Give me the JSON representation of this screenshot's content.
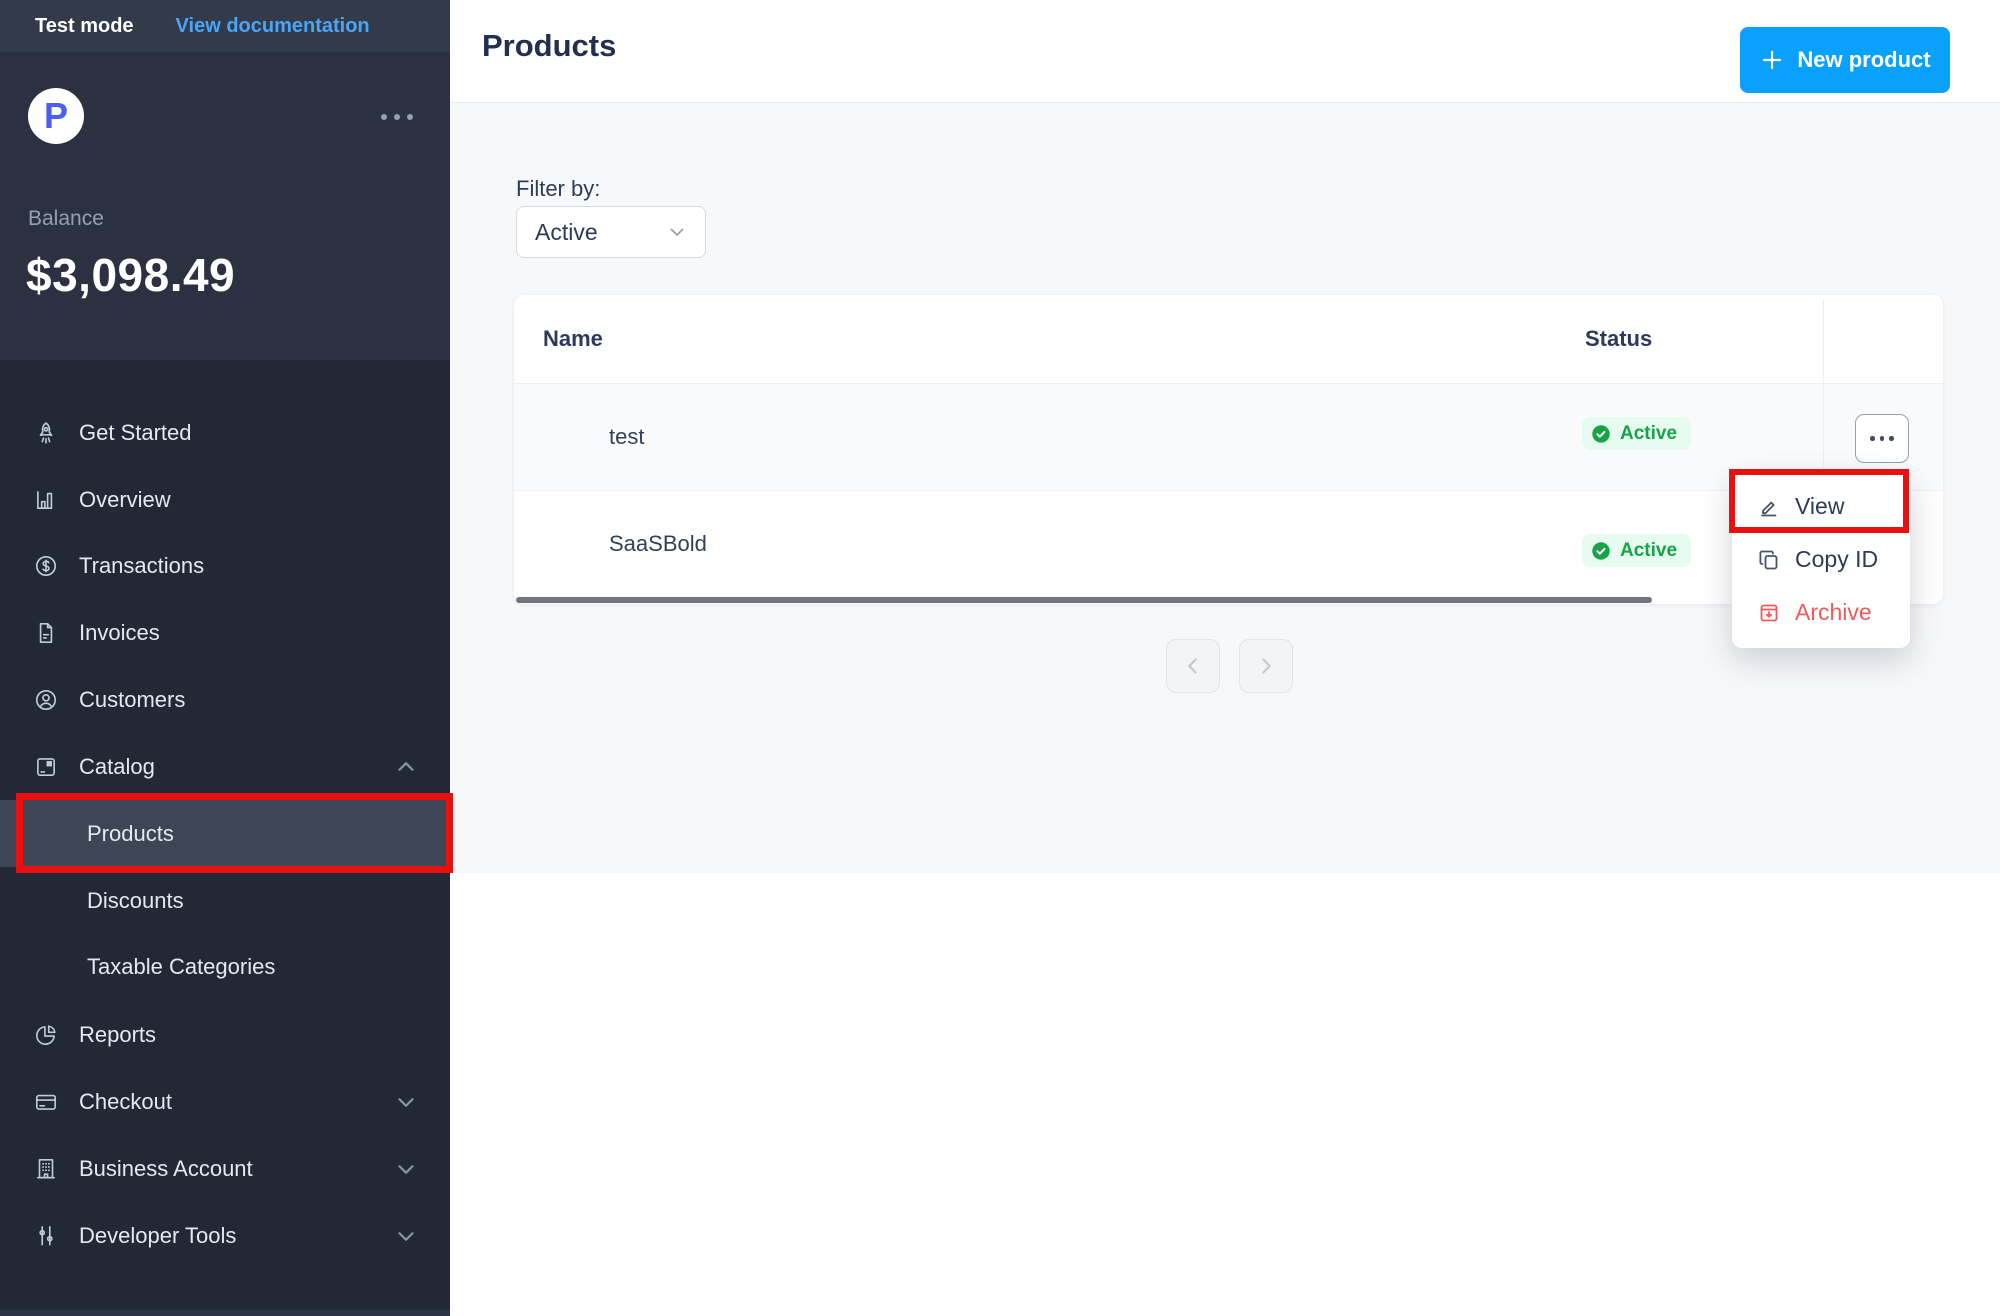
{
  "sidebar": {
    "topbar": {
      "mode_label": "Test mode",
      "doc_link": "View documentation"
    },
    "logo_letter": "P",
    "balance": {
      "label": "Balance",
      "amount": "$3,098.49"
    },
    "nav": [
      {
        "label": "Get Started",
        "icon": "rocket-icon"
      },
      {
        "label": "Overview",
        "icon": "bar-chart-icon"
      },
      {
        "label": "Transactions",
        "icon": "dollar-circle-icon"
      },
      {
        "label": "Invoices",
        "icon": "invoice-icon"
      },
      {
        "label": "Customers",
        "icon": "person-circle-icon"
      },
      {
        "label": "Catalog",
        "icon": "package-icon",
        "chevron": "up"
      },
      {
        "label": "Products",
        "sub": true,
        "active": true,
        "annotated": true
      },
      {
        "label": "Discounts",
        "sub": true
      },
      {
        "label": "Taxable Categories",
        "sub": true
      },
      {
        "label": "Reports",
        "icon": "pie-chart-icon"
      },
      {
        "label": "Checkout",
        "icon": "credit-card-icon",
        "chevron": "down"
      },
      {
        "label": "Business Account",
        "icon": "building-icon",
        "chevron": "down"
      },
      {
        "label": "Developer Tools",
        "icon": "sliders-icon",
        "chevron": "down"
      }
    ]
  },
  "header": {
    "title": "Products",
    "new_product_label": "New product"
  },
  "filter": {
    "label": "Filter by:",
    "value": "Active"
  },
  "table": {
    "columns": {
      "name": "Name",
      "status": "Status"
    },
    "rows": [
      {
        "name": "test",
        "status": "Active"
      },
      {
        "name": "SaaSBold",
        "status": "Active"
      }
    ]
  },
  "row_menu": {
    "view": "View",
    "copy_id": "Copy ID",
    "archive": "Archive"
  },
  "icons": {
    "sidebar": [
      "rocket-icon",
      "bar-chart-icon",
      "dollar-circle-icon",
      "invoice-icon",
      "person-circle-icon",
      "package-icon",
      "pie-chart-icon",
      "credit-card-icon",
      "building-icon",
      "sliders-icon",
      "chevron-up-icon",
      "chevron-down-icon",
      "ellipsis-icon"
    ],
    "main": [
      "plus-icon",
      "check-circle-icon",
      "ellipsis-icon",
      "pencil-icon",
      "copy-icon",
      "archive-box-icon",
      "chevron-left-icon",
      "chevron-right-icon"
    ]
  },
  "colors": {
    "accent_blue": "#0aa1fc",
    "link_blue": "#4aa4f8",
    "badge_green": "#16a34a",
    "badge_bg": "#e8fbf0",
    "danger_red": "#f15a5a",
    "annotation_red": "#e91010",
    "sidebar_bg": "#222835",
    "content_bg": "#f7f8fa"
  }
}
